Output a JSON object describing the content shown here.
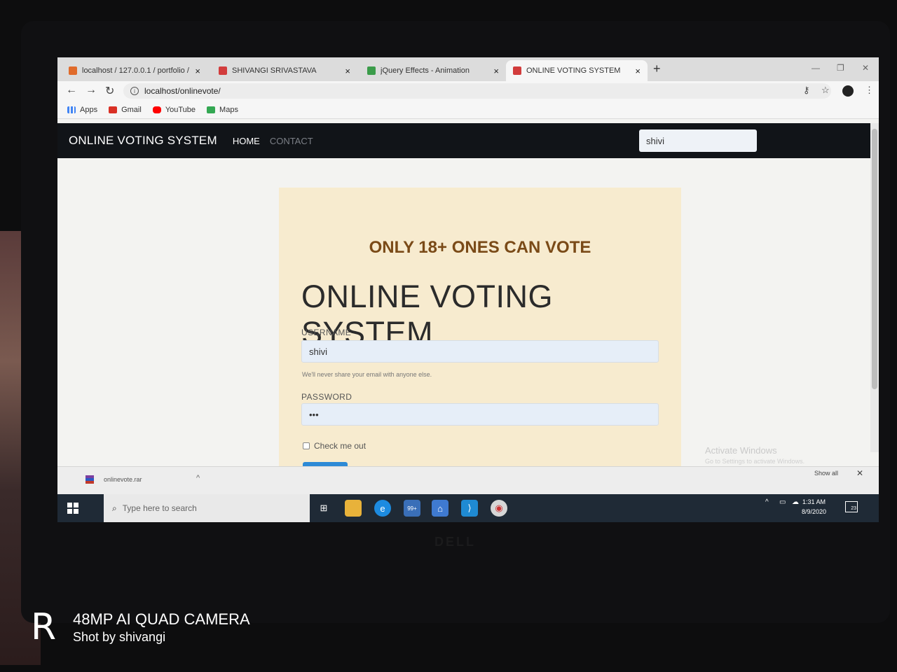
{
  "browser": {
    "tabs": [
      {
        "title": "localhost / 127.0.0.1 / portfolio /",
        "favicon": "phpmyadmin-icon",
        "active": false
      },
      {
        "title": "SHIVANGI SRIVASTAVA",
        "favicon": "html-file-icon",
        "active": false
      },
      {
        "title": "jQuery Effects - Animation",
        "favicon": "w3schools-icon",
        "active": false
      },
      {
        "title": "ONLINE VOTING SYSTEM",
        "favicon": "html-file-icon",
        "active": true
      }
    ],
    "new_tab": "+",
    "close_glyph": "×",
    "address": "localhost/onlinevote/",
    "bookmarks": [
      "Apps",
      "Gmail",
      "YouTube",
      "Maps"
    ]
  },
  "site": {
    "brand": "ONLINE VOTING SYSTEM",
    "nav": {
      "home": "HOME",
      "contact": "CONTACT"
    },
    "search_value": "shivi"
  },
  "form": {
    "age_note": "ONLY 18+ ONES CAN VOTE",
    "title": "ONLINE VOTING SYSTEM",
    "username_label": "USERNAME",
    "username_value": "shivi",
    "username_hint": "We'll never share your email with anyone else.",
    "password_label": "PASSWORD",
    "password_value": "•••",
    "checkbox_label": "Check me out"
  },
  "activation_watermark": {
    "line1": "Activate Windows",
    "line2": "Go to Settings to activate Windows."
  },
  "downloads": {
    "file": "onlinevote.rar",
    "show_all": "Show all"
  },
  "taskbar": {
    "search_placeholder": "Type here to search",
    "mail_badge": "99+",
    "time": "1:31 AM",
    "date": "8/9/2020",
    "notification_count": "23"
  },
  "laptop_brand": "DELL",
  "camera_watermark": {
    "logo": "R",
    "line1": "48MP AI QUAD CAMERA",
    "line2": "Shot by shivangi"
  },
  "colors": {
    "site_nav": "#111418",
    "card": "#f7ebcf",
    "age_note": "#7a4a17",
    "taskbar": "#1f2a36",
    "submit": "#2d8ad6"
  }
}
